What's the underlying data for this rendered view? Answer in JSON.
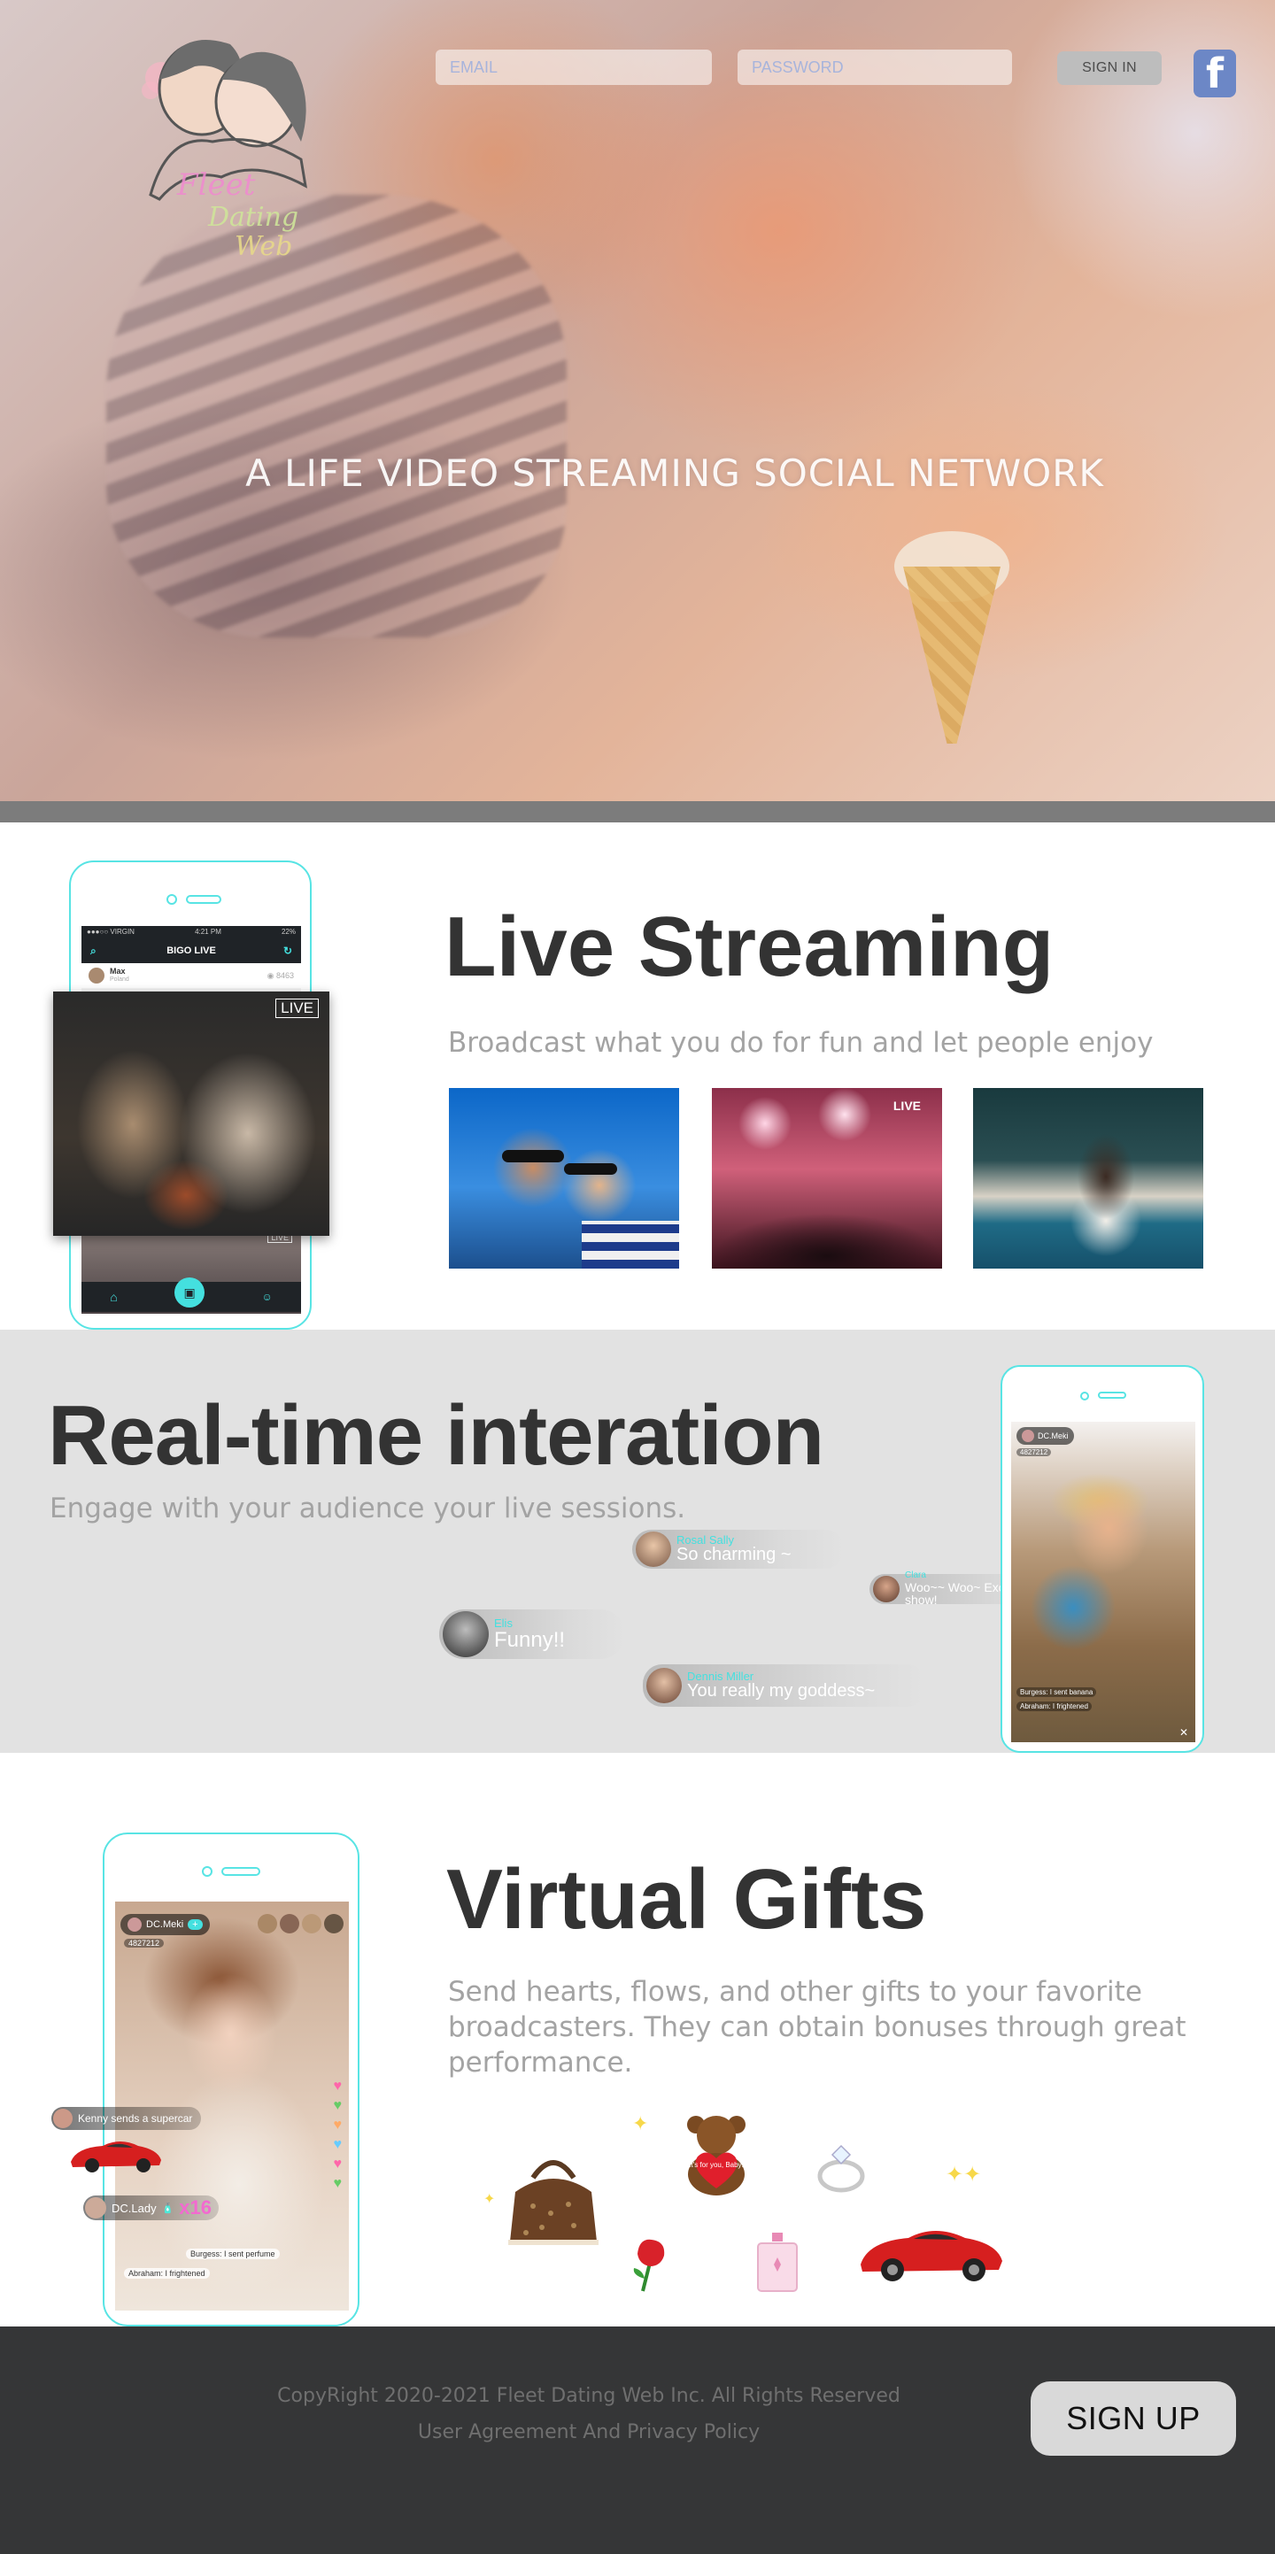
{
  "header": {
    "logo_text": "Fleet Dating Web",
    "email_placeholder": "EMAIL",
    "password_placeholder": "PASSWORD",
    "signin_label": "SIGN IN",
    "facebook_glyph": "f",
    "tagline": "A LIFE VIDEO STREAMING SOCIAL NETWORK"
  },
  "live_streaming": {
    "title": "Live Streaming",
    "subtitle": "Broadcast what you do for fun and let people enjoy",
    "phone": {
      "status_left": "●●●○○ VIRGIN",
      "status_time": "4:21 PM",
      "status_battery": "22%",
      "app_title": "BIGO LIVE",
      "user_name": "Max",
      "user_location": "Poland",
      "viewers": "8463",
      "live_badge": "LIVE",
      "live_badge_small": "LIVE"
    },
    "photo_badge": "LIVE"
  },
  "realtime": {
    "title": "Real-time interation",
    "subtitle": "Engage with your audience  your live sessions.",
    "comments": [
      {
        "name": "Rosal Sally",
        "message": "So charming ~"
      },
      {
        "name": "Clara",
        "message": "Woo~~ Woo~ Excellent show!"
      },
      {
        "name": "Elis",
        "message": "Funny!!"
      },
      {
        "name": "Dennis Miller",
        "message": "You really my goddess~"
      }
    ],
    "phone": {
      "host": "DC.Meki",
      "host_id": "4827212",
      "chat": [
        "Burgess: I sent banana",
        "Abraham: I frightened"
      ]
    }
  },
  "gifts": {
    "title": "Virtual Gifts",
    "subtitle": "Send hearts, flows, and other gifts to your favorite broadcasters. They can obtain bonuses through great performance.",
    "bear_text": "It's for you, Baby!",
    "phone": {
      "host": "DC.Meki",
      "host_id": "4827212",
      "gift_notice": "Kenny sends a supercar",
      "combo_user": "DC.Lady",
      "combo_count": "x16",
      "chat": [
        "Burgess: I sent perfume",
        "Abraham: I frightened"
      ]
    }
  },
  "footer": {
    "copyright": "CopyRight  2020-2021 Fleet Dating Web Inc. All Rights Reserved",
    "links": "User Agreement And Privacy Policy",
    "signup_label": "SIGN UP"
  },
  "colors": {
    "accent_cyan": "#58e4e4",
    "heading": "#333333",
    "subtext": "#a3a3a3",
    "footer_bg": "#353637",
    "facebook": "#6c87c6"
  }
}
